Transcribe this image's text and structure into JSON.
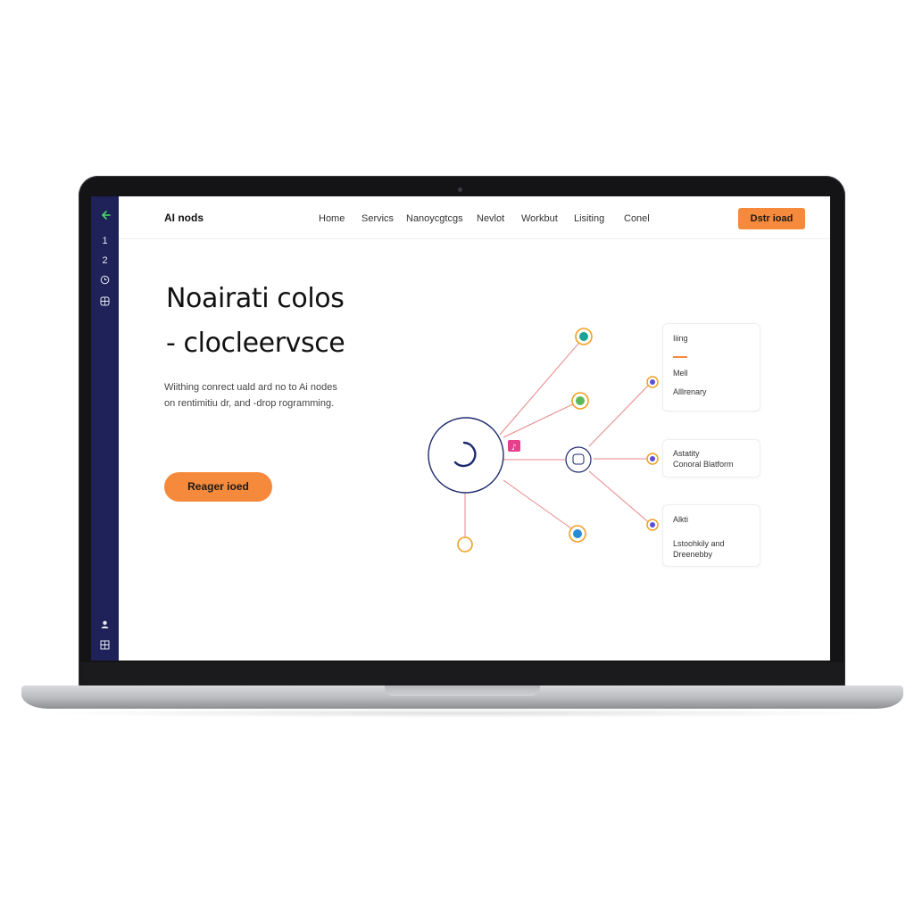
{
  "app": {
    "brand": "AI nods"
  },
  "sidebar": {
    "items": [
      {
        "label": "1",
        "name": "sidebar-item-1"
      },
      {
        "label": "2",
        "name": "sidebar-item-2"
      }
    ]
  },
  "nav": {
    "links": [
      "Home",
      "Servics",
      "Nanoycgtcgs",
      "Nevlot",
      "Workbut",
      "Lisiting",
      "Conel"
    ],
    "cta_label": "Dstr ioad"
  },
  "hero": {
    "title_line1": "Noairati colos",
    "title_line2": "- clocleervsce",
    "subtitle_line1": "Wiithing conrect uald ard no to Ai nodes",
    "subtitle_line2": "on rentimitiu dr, and -drop rogramming.",
    "cta_label": "Reager ioed"
  },
  "cards": [
    {
      "lines": [
        "Iiing",
        "Mell",
        "Alllrenary"
      ]
    },
    {
      "lines": [
        "Astatity",
        "Conoral Blatform"
      ]
    },
    {
      "lines": [
        "Alkti",
        "Lstoohkily and",
        "Dreenebby"
      ]
    }
  ],
  "colors": {
    "accent": "#f58a3c",
    "sidebar": "#1e2258",
    "hub": "#1e2a6e",
    "edge": "#e8868a",
    "node_magenta": "#e83e8c"
  }
}
